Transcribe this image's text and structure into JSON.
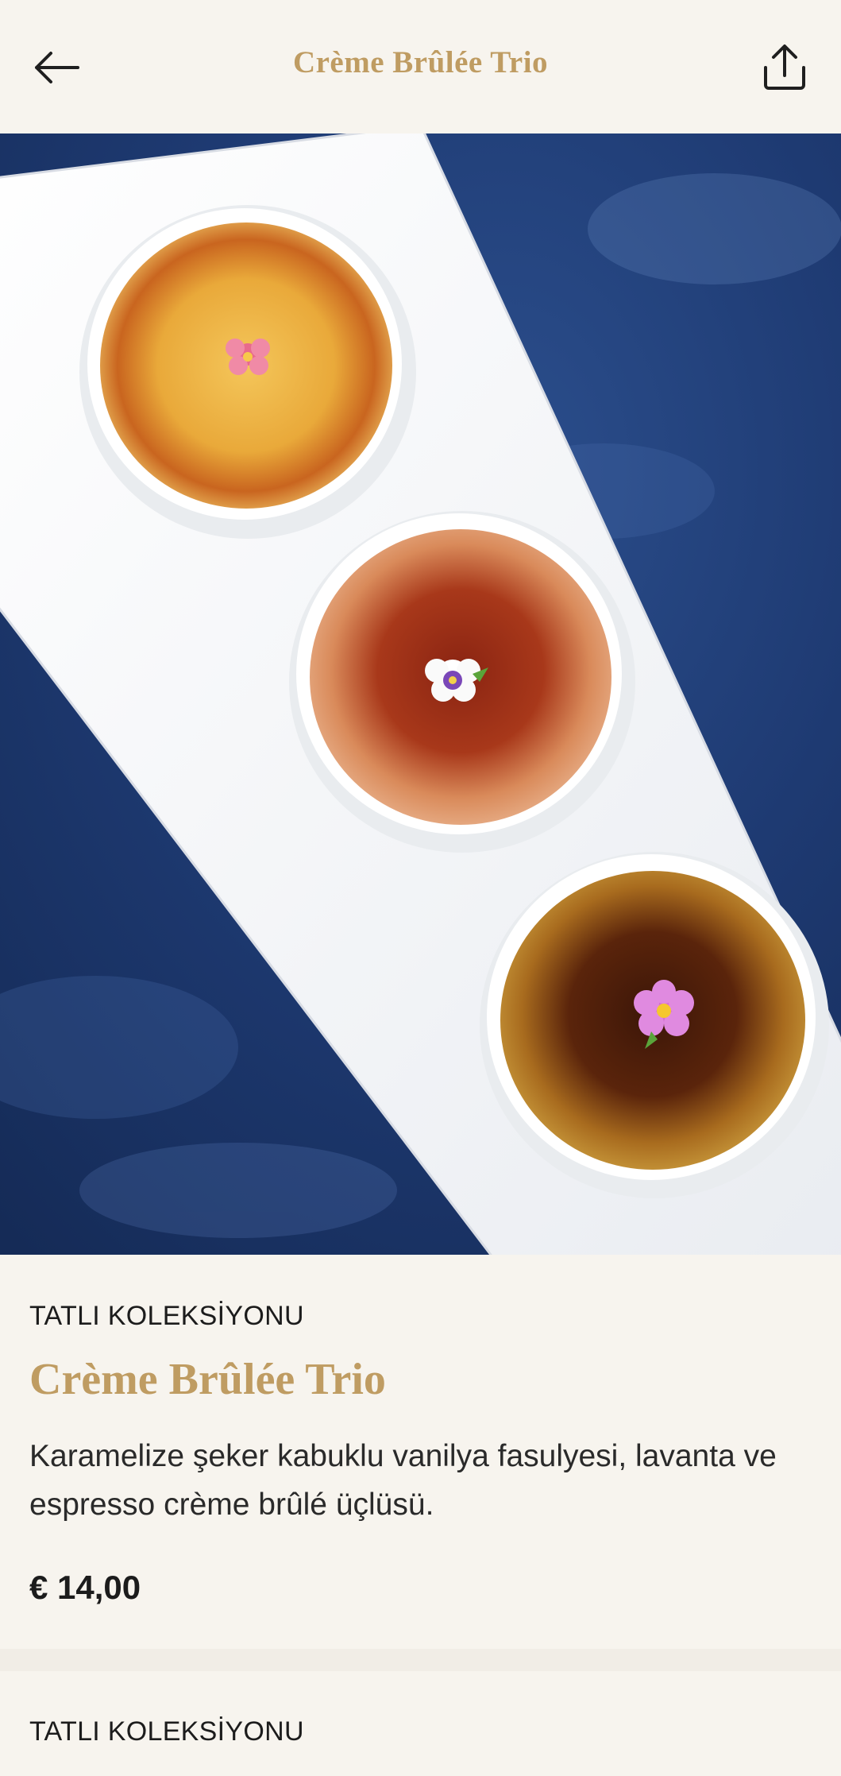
{
  "header": {
    "title": "Crème Brûlée Trio",
    "back_icon": "arrow-left-icon",
    "share_icon": "share-icon"
  },
  "hero": {
    "image_subject": "three crème brûlée ramekins on a white platter over a blue textured cloth"
  },
  "product": {
    "category": "TATLI KOLEKSİYONU",
    "title": "Crème Brûlée Trio",
    "description": "Karamelize şeker kabuklu vanilya fasulyesi, lavanta ve espresso crème brûlé üçlüsü.",
    "price": "€ 14,00"
  },
  "next_item": {
    "category": "TATLI KOLEKSİYONU"
  },
  "colors": {
    "accent_gold": "#bf9c62",
    "background": "#f7f4ee",
    "cloth_blue": "#1f3c72"
  }
}
